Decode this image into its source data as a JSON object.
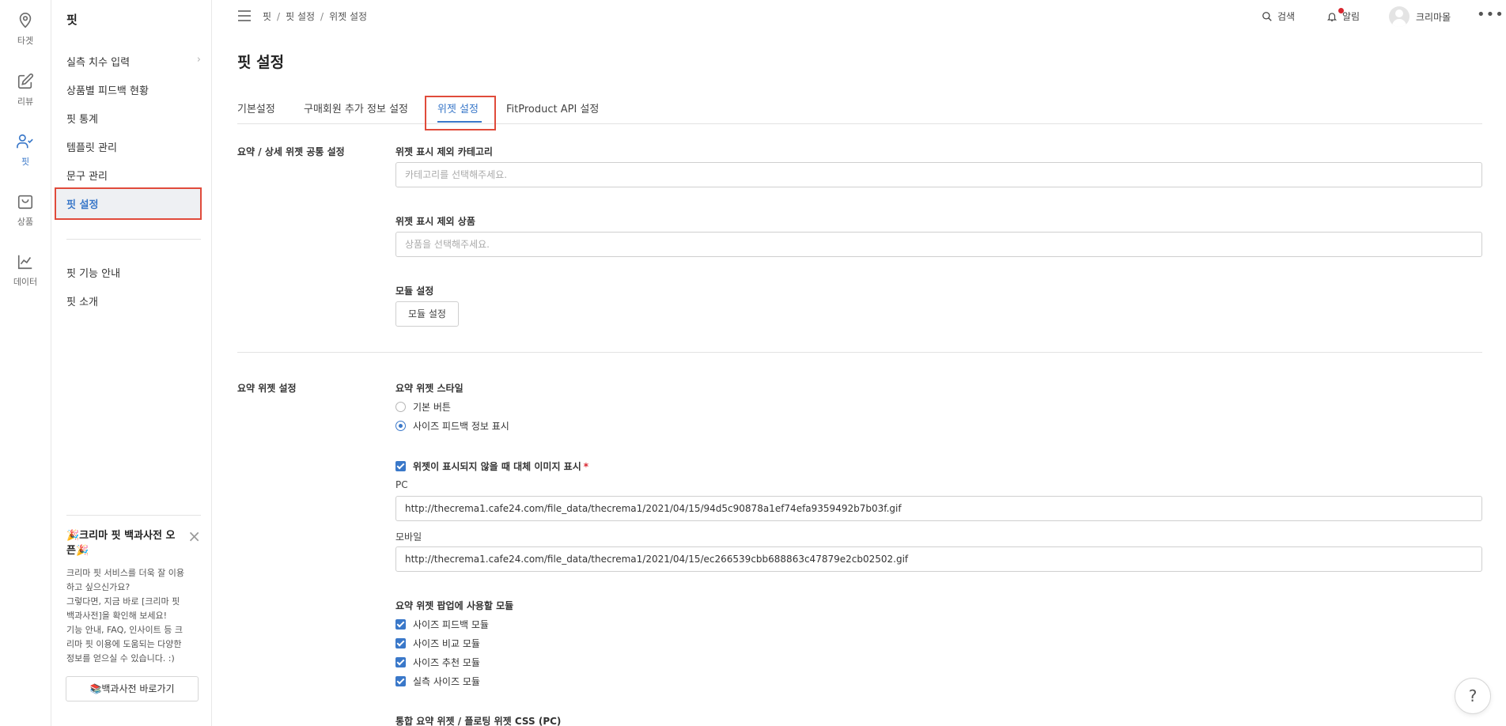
{
  "rail": {
    "items": [
      {
        "label": "타겟",
        "icon": "map-pin-icon"
      },
      {
        "label": "리뷰",
        "icon": "edit-icon"
      },
      {
        "label": "핏",
        "icon": "user-check-icon"
      },
      {
        "label": "상품",
        "icon": "shopping-bag-icon"
      },
      {
        "label": "데이터",
        "icon": "line-chart-icon"
      }
    ],
    "active_color": "#3a78c9"
  },
  "subnav": {
    "title": "핏",
    "items": [
      {
        "label": "실측 치수 입력"
      },
      {
        "label": "상품별 피드백 현황"
      },
      {
        "label": "핏 통계"
      },
      {
        "label": "템플릿 관리"
      },
      {
        "label": "문구 관리"
      },
      {
        "label": "핏 설정"
      }
    ],
    "secondary": [
      {
        "label": "핏 기능 안내"
      },
      {
        "label": "핏 소개"
      }
    ],
    "promo": {
      "title": "🎉크리마 핏 백과사전 오픈🎉",
      "body_lines": [
        "크리마 핏 서비스를 더욱 잘 이용",
        "하고 싶으신가요?",
        "그렇다면, 지금 바로 [크리마 핏",
        "백과사전]을 확인해 보세요!",
        "기능 안내, FAQ, 인사이트 등 크",
        "리마 핏 이용에 도움되는 다양한",
        "정보를 얻으실 수 있습니다. :)"
      ],
      "button": "📚백과사전 바로가기"
    }
  },
  "topbar": {
    "breadcrumb": [
      "핏",
      "핏 설정",
      "위젯 설정"
    ],
    "search": "검색",
    "alerts": "알림",
    "user": "크리마몰"
  },
  "main": {
    "page_title": "핏 설정",
    "tabs": [
      {
        "label": "기본설정"
      },
      {
        "label": "구매회원 추가 정보 설정"
      },
      {
        "label": "위젯 설정"
      },
      {
        "label": "FitProduct API 설정"
      }
    ],
    "common": {
      "section_label": "요약 / 상세 위젯 공통 설정",
      "exclude_category_label": "위젯 표시 제외 카테고리",
      "exclude_category_placeholder": "카테고리를 선택해주세요.",
      "exclude_product_label": "위젯 표시 제외 상품",
      "exclude_product_placeholder": "상품을 선택해주세요.",
      "module_label": "모듈 설정",
      "module_button": "모듈 설정"
    },
    "summary": {
      "section_label": "요약 위젯 설정",
      "style_label": "요약 위젯 스타일",
      "style_options": [
        "기본 버튼",
        "사이즈 피드백 정보 표시"
      ],
      "fallback_label": "위젯이 표시되지 않을 때 대체 이미지 표시",
      "required_mark": "*",
      "pc_label": "PC",
      "pc_value": "http://thecrema1.cafe24.com/file_data/thecrema1/2021/04/15/94d5c90878a1ef74efa9359492b7b03f.gif",
      "mobile_label": "모바일",
      "mobile_value": "http://thecrema1.cafe24.com/file_data/thecrema1/2021/04/15/ec266539cbb688863c47879e2cb02502.gif",
      "popup_modules_label": "요약 위젯 팝업에 사용할 모듈",
      "popup_modules": [
        "사이즈 피드백 모듈",
        "사이즈 비교 모듈",
        "사이즈 추천 모듈",
        "실측 사이즈 모듈"
      ],
      "css_label": "통합 요약 위젯 / 플로팅 위젯 CSS (PC)"
    }
  },
  "help": "?"
}
